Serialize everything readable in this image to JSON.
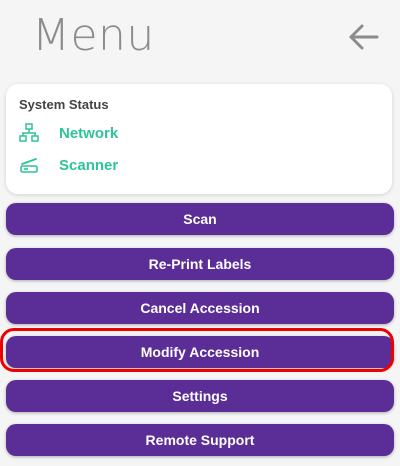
{
  "header": {
    "title": "Menu",
    "back_icon": "arrow-left-icon"
  },
  "status": {
    "title": "System Status",
    "items": [
      {
        "label": "Network",
        "icon": "network-icon"
      },
      {
        "label": "Scanner",
        "icon": "scanner-icon"
      }
    ],
    "ok_color": "#2fc39b"
  },
  "menu": {
    "items": [
      {
        "label": "Scan"
      },
      {
        "label": "Re-Print Labels"
      },
      {
        "label": "Cancel Accession"
      },
      {
        "label": "Modify Accession",
        "highlighted": true
      },
      {
        "label": "Settings"
      },
      {
        "label": "Remote Support"
      }
    ],
    "button_color": "#5b2d96",
    "highlight_color": "#ee0000"
  }
}
